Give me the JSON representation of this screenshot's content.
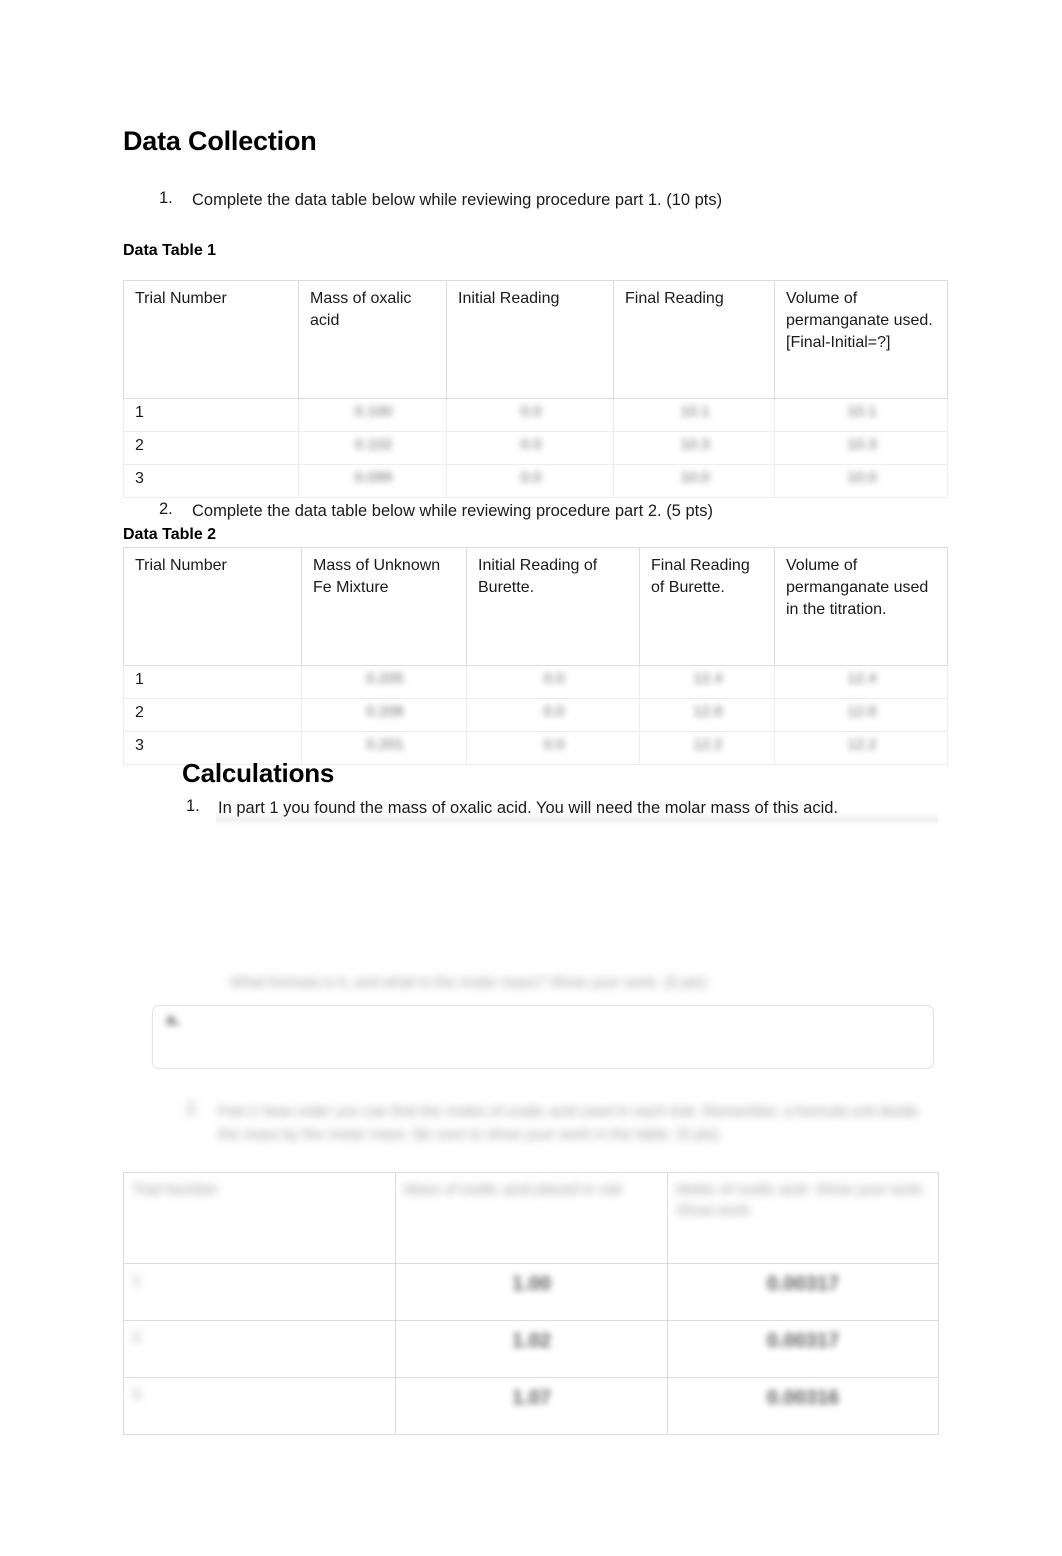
{
  "document": {
    "section1_title": "Data Collection",
    "section2_title": "Calculations"
  },
  "instructions": {
    "item1_number": "1.",
    "item1_text": "Complete the data table below while reviewing procedure part 1. (10 pts)",
    "item2_number": "2.",
    "item2_text": "Complete the data table below while reviewing procedure part 2. (5 pts)"
  },
  "labels": {
    "data_table_1": "Data Table 1",
    "data_table_2": "Data Table 2"
  },
  "table1": {
    "headers": [
      "Trial Number",
      "Mass of oxalic acid",
      "Initial Reading",
      "Final Reading",
      "Volume of permanganate used. [Final-Initial=?]"
    ],
    "rows": [
      {
        "trial": "1",
        "mass": "0.100",
        "initial": "0.0",
        "final": "10.1",
        "volume": "10.1"
      },
      {
        "trial": "2",
        "mass": "0.102",
        "initial": "0.0",
        "final": "10.3",
        "volume": "10.3"
      },
      {
        "trial": "3",
        "mass": "0.099",
        "initial": "0.0",
        "final": "10.0",
        "volume": "10.0"
      }
    ]
  },
  "table2": {
    "headers": [
      "Trial Number",
      "Mass of Unknown Fe Mixture",
      "Initial Reading of Burette.",
      " Final Reading of Burette.",
      "Volume of permanganate used in the titration."
    ],
    "rows": [
      {
        "trial": "1",
        "mass": "0.205",
        "initial": "0.0",
        "final": "12.4",
        "volume": "12.4"
      },
      {
        "trial": "2",
        "mass": "0.208",
        "initial": "0.0",
        "final": "12.6",
        "volume": "12.6"
      },
      {
        "trial": "3",
        "mass": "0.201",
        "initial": "0.0",
        "final": "12.2",
        "volume": "12.2"
      }
    ]
  },
  "calculations": {
    "item1_number": "1.",
    "item1_text": "In part 1 you found the mass of oxalic acid. You will need the molar mass of this acid.",
    "item1a_text": "What formula is it, and what is the molar mass? Show your work. (5 pts)",
    "answer_mark": "a.",
    "item2_number": "2.",
    "item2_text": "Part 2 Now order you can find the moles of oxalic acid used in each trial. Remember, a formula unit divide the mass by the molar mass. Be sure to show your work in the table. (5 pts)"
  },
  "table3": {
    "headers": [
      "Trial Number",
      "Mass of oxalic acid placed in vial",
      "Moles of oxalic acid. Show your work. Show work.",
      ""
    ],
    "rows": [
      {
        "trial": "1",
        "mass": "1.00",
        "moles": "0.00317"
      },
      {
        "trial": "2",
        "mass": "1.02",
        "moles": "0.00317"
      },
      {
        "trial": "3",
        "mass": "1.07",
        "moles": "0.00316"
      }
    ]
  }
}
